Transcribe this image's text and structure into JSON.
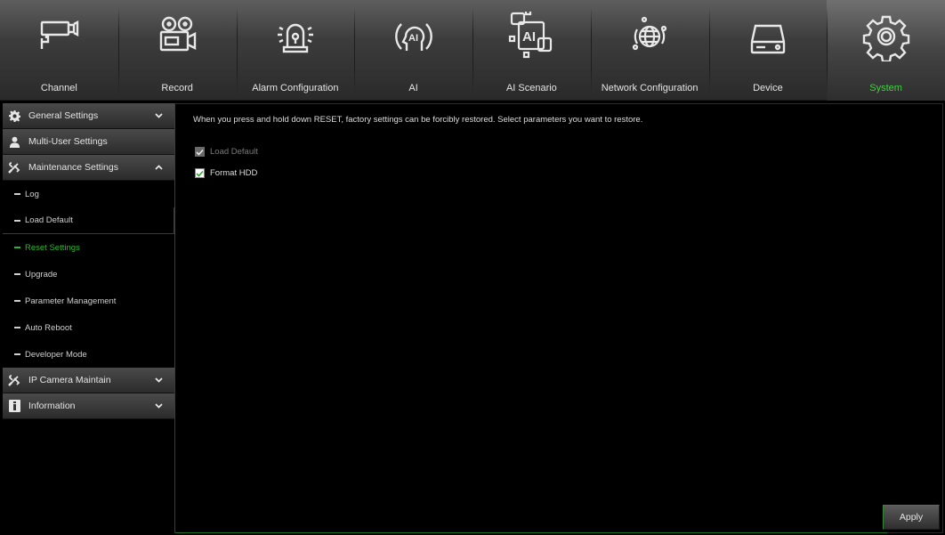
{
  "topnav": {
    "items": [
      {
        "label": "Channel",
        "icon": "camera-icon",
        "active": false
      },
      {
        "label": "Record",
        "icon": "video-camera-icon",
        "active": false
      },
      {
        "label": "Alarm Configuration",
        "icon": "alarm-siren-icon",
        "active": false
      },
      {
        "label": "AI",
        "icon": "ai-head-icon",
        "active": false
      },
      {
        "label": "AI Scenario",
        "icon": "ai-scenario-icon",
        "active": false
      },
      {
        "label": "Network Configuration",
        "icon": "globe-icon",
        "active": false
      },
      {
        "label": "Device",
        "icon": "hdd-icon",
        "active": false
      },
      {
        "label": "System",
        "icon": "gear-icon",
        "active": true
      }
    ],
    "active_color": "#3bd43b"
  },
  "sidebar": {
    "groups": [
      {
        "label": "General Settings",
        "icon": "gear-icon",
        "expanded": false
      },
      {
        "label": "Multi-User Settings",
        "icon": "user-icon",
        "expanded": false
      },
      {
        "label": "Maintenance Settings",
        "icon": "tools-icon",
        "expanded": true,
        "items": [
          "Log",
          "Load Default",
          "Reset Settings",
          "Upgrade",
          "Parameter Management",
          "Auto Reboot",
          "Developer Mode"
        ],
        "active_item": "Reset Settings"
      },
      {
        "label": "IP Camera Maintain",
        "icon": "tools-icon",
        "expanded": false
      },
      {
        "label": "Information",
        "icon": "info-icon",
        "expanded": false
      }
    ]
  },
  "main": {
    "notice": "When you press and hold down RESET, factory settings can be forcibly restored. Select parameters you want to restore.",
    "options": [
      {
        "label": "Load Default",
        "checked": true,
        "enabled": false
      },
      {
        "label": "Format HDD",
        "checked": true,
        "enabled": true
      }
    ],
    "apply_label": "Apply"
  }
}
